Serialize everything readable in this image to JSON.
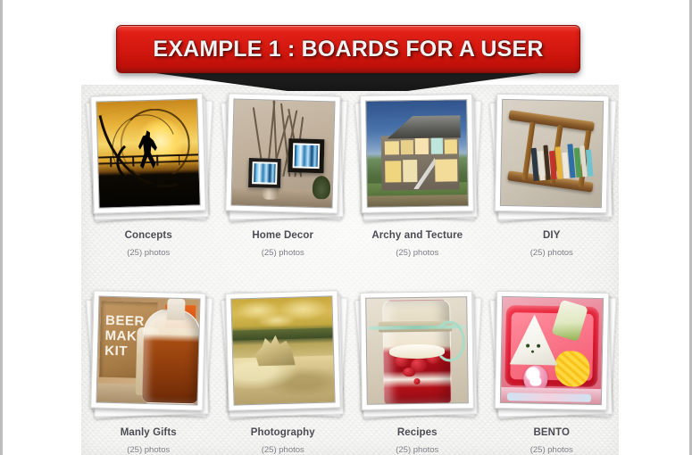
{
  "banner": {
    "title": "EXAMPLE 1 : BOARDS FOR A USER",
    "color": "#d3180f"
  },
  "boards": [
    {
      "title": "Concepts",
      "count": "(25) photos",
      "thumb": "runner-sunset-silhouette-photo"
    },
    {
      "title": "Home Decor",
      "count": "(25) photos",
      "thumb": "framed-art-and-branches-photo"
    },
    {
      "title": "Archy and Tecture",
      "count": "(25) photos",
      "thumb": "open-house-at-dusk-photo"
    },
    {
      "title": "DIY",
      "count": "(25) photos",
      "thumb": "ladder-bookshelf-photo"
    },
    {
      "title": "Manly Gifts",
      "count": "(25) photos",
      "thumb": "beer-making-kit-photo"
    },
    {
      "title": "Photography",
      "count": "(25) photos",
      "thumb": "golden-landscape-photo"
    },
    {
      "title": "Recipes",
      "count": "(25) photos",
      "thumb": "mason-jar-dessert-photo"
    },
    {
      "title": "BENTO",
      "count": "(25) photos",
      "thumb": "bento-box-onigiri-photo"
    }
  ],
  "thumb_text": {
    "beer_kit_line1": "BEER",
    "beer_kit_line2": "MAKIN",
    "beer_kit_line3": "KIT"
  }
}
